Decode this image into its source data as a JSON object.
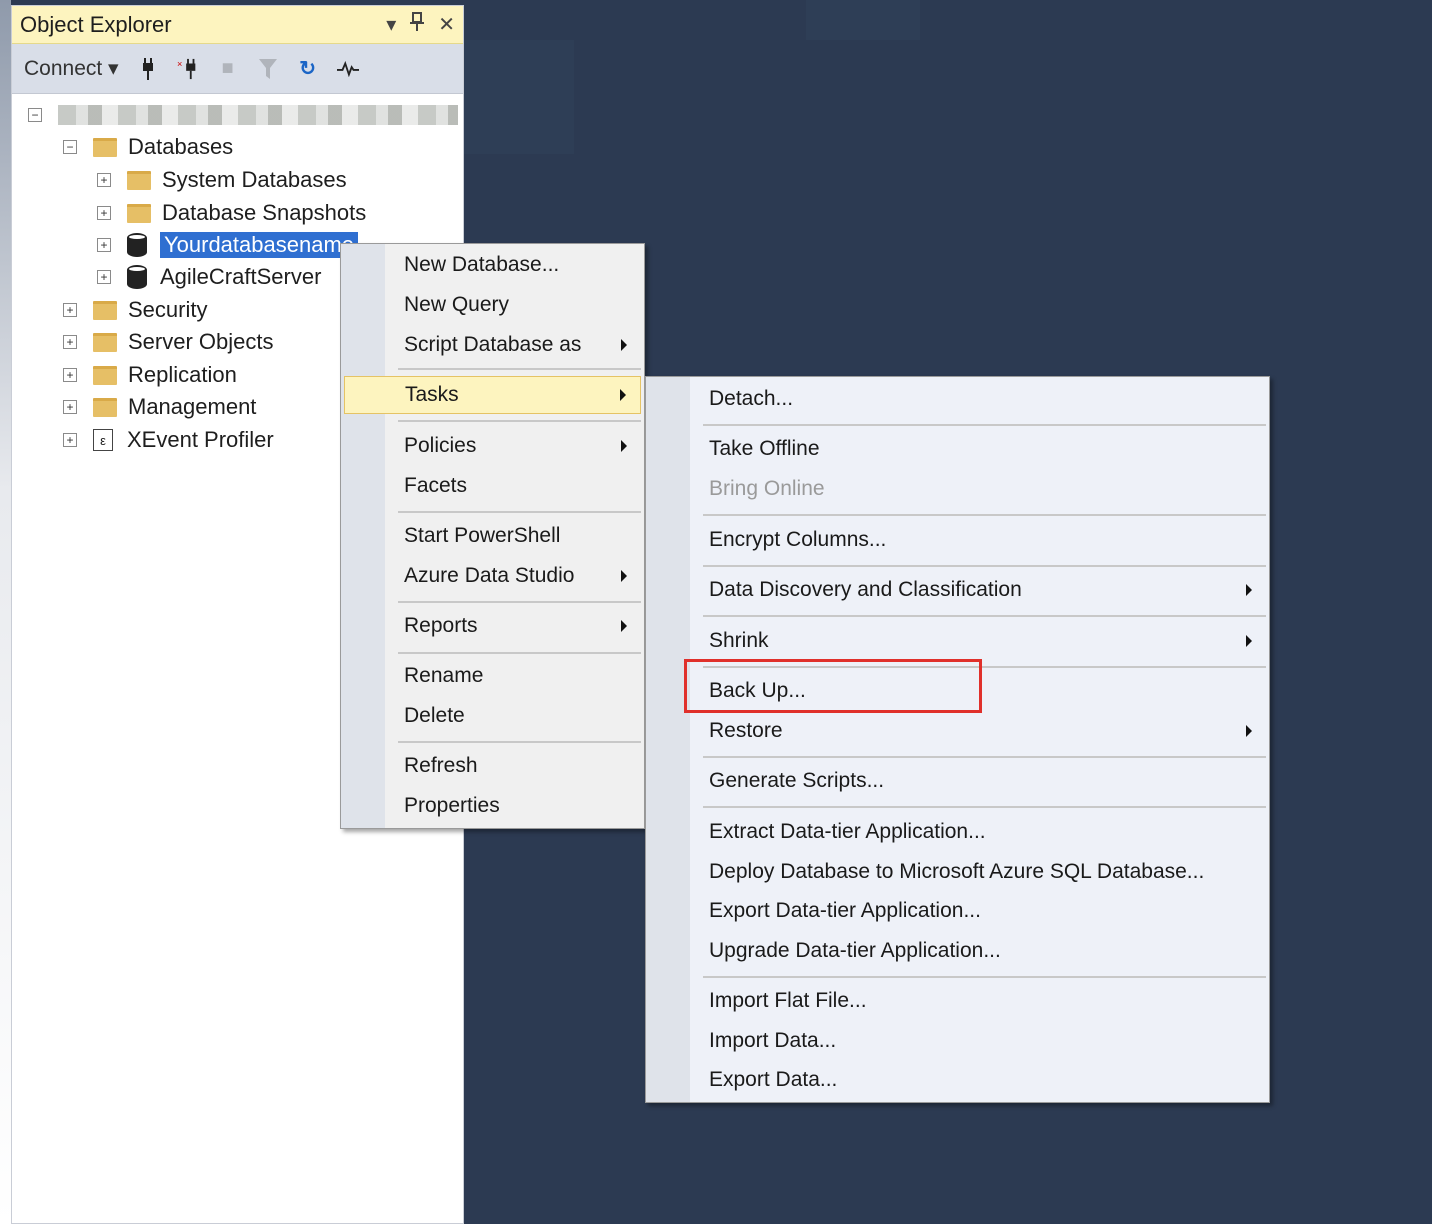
{
  "object_explorer": {
    "title": "Object Explorer",
    "title_controls": [
      "▾",
      "⇕",
      "✕"
    ],
    "toolbar": {
      "connect_label": "Connect ▾",
      "icons": [
        "connect-icon",
        "disconnect-icon",
        "stop-icon",
        "filter-icon",
        "refresh-icon",
        "activity-monitor-icon"
      ]
    },
    "tree": {
      "server": "[server name obscured]",
      "databases": "Databases",
      "system_databases": "System Databases",
      "database_snapshots": "Database Snapshots",
      "selected_db": "Yourdatabasename",
      "agilecraft": "AgileCraftServer",
      "security": "Security",
      "server_objects": "Server Objects",
      "replication": "Replication",
      "management": "Management",
      "xevent": "XEvent Profiler"
    }
  },
  "context_menu": {
    "new_database": "New Database...",
    "new_query": "New Query",
    "script_database_as": "Script Database as",
    "tasks": "Tasks",
    "policies": "Policies",
    "facets": "Facets",
    "start_powershell": "Start PowerShell",
    "azure_data_studio": "Azure Data Studio",
    "reports": "Reports",
    "rename": "Rename",
    "delete": "Delete",
    "refresh": "Refresh",
    "properties": "Properties"
  },
  "tasks_menu": {
    "detach": "Detach...",
    "take_offline": "Take Offline",
    "bring_online": "Bring Online",
    "encrypt_columns": "Encrypt Columns...",
    "data_discovery": "Data Discovery and Classification",
    "shrink": "Shrink",
    "back_up": "Back Up...",
    "restore": "Restore",
    "generate_scripts": "Generate Scripts...",
    "extract_dac": "Extract Data-tier Application...",
    "deploy_azure": "Deploy Database to Microsoft Azure SQL Database...",
    "export_dac": "Export Data-tier Application...",
    "upgrade_dac": "Upgrade Data-tier Application...",
    "import_flat": "Import Flat File...",
    "import_data": "Import Data...",
    "export_data": "Export Data..."
  },
  "colors": {
    "background": "#2c3a52",
    "selection": "#2f6fd1",
    "menu_highlight": "#fdf4bf",
    "callout": "#e0302b"
  }
}
